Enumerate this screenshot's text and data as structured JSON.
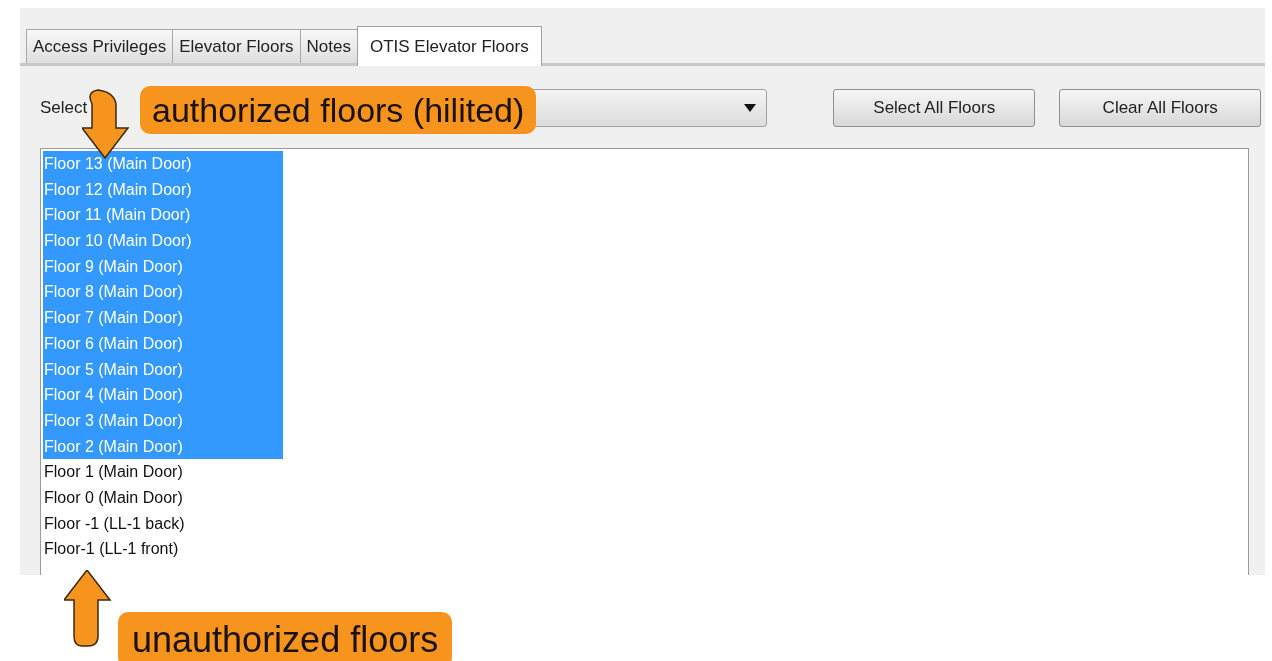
{
  "tabs": [
    {
      "label": "Access Privileges",
      "selected": false
    },
    {
      "label": "Elevator Floors",
      "selected": false
    },
    {
      "label": "Notes",
      "selected": false
    },
    {
      "label": "OTIS Elevator Floors",
      "selected": true
    }
  ],
  "elevator_select": {
    "label": "Select"
  },
  "buttons": [
    "Select All Floors",
    "Clear All Floors"
  ],
  "floors": [
    {
      "label": "Floor 13 (Main Door)",
      "selected": true
    },
    {
      "label": "Floor 12 (Main Door)",
      "selected": true
    },
    {
      "label": "Floor 11 (Main Door)",
      "selected": true
    },
    {
      "label": "Floor 10 (Main Door)",
      "selected": true
    },
    {
      "label": "Floor 9 (Main Door)",
      "selected": true
    },
    {
      "label": "Floor 8 (Main Door)",
      "selected": true
    },
    {
      "label": "Floor 7 (Main Door)",
      "selected": true
    },
    {
      "label": "Floor 6 (Main Door)",
      "selected": true
    },
    {
      "label": "Floor 5 (Main Door)",
      "selected": true
    },
    {
      "label": "Floor 4 (Main Door)",
      "selected": true
    },
    {
      "label": "Floor 3 (Main Door)",
      "selected": true
    },
    {
      "label": "Floor 2 (Main Door)",
      "selected": true
    },
    {
      "label": "Floor 1 (Main Door)",
      "selected": false
    },
    {
      "label": "Floor 0 (Main Door)",
      "selected": false
    },
    {
      "label": "Floor -1 (LL-1 back)",
      "selected": false
    },
    {
      "label": "Floor-1 (LL-1 front)",
      "selected": false
    }
  ],
  "callouts": [
    {
      "text": "authorized floors (hilited)",
      "kind": "down"
    },
    {
      "text": "unauthorized floors",
      "kind": "up"
    }
  ]
}
